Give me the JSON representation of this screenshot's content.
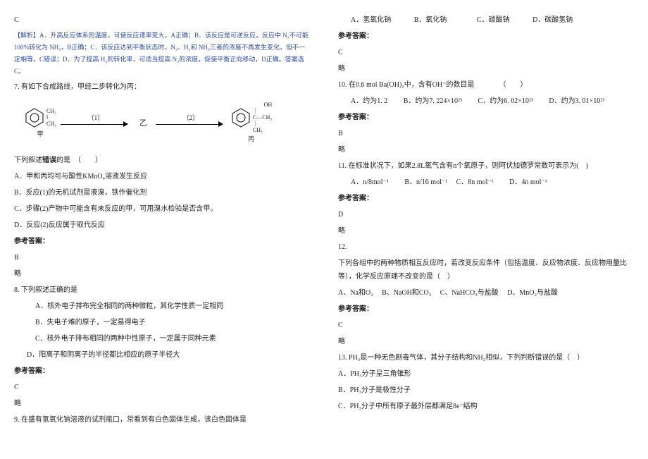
{
  "left": {
    "ansLetterC": "C",
    "analysis": "【解析】A．升高反应体系的温度，可使反应速率变大，A正确；B．该反应是可逆反应，反应中 N₂不可能 100%转化为 NH₃，B正确；C．该反应达到平衡状态时，N₂、H₂和 NH₃三者的浓度不再发生变化，但不一定相等，C错误；D．为了提高 H₂的转化率，可适当提高 N₂的浓度，促使平衡正向移动，D正确。答案选 C。",
    "q7": "7. 有如下合成路线，甲经二步转化为丙：",
    "q7_hint": "下列叙述错误的是　（　　）",
    "q7a": "A．甲和丙均可与酸性KMnO₄溶液发生反应",
    "q7b": "B．反应(1)的无机试剂是液溴，铁作催化剂",
    "q7c": "C．步骤(2)产物中可能含有未反应的甲，可用溴水检验是否含甲。",
    "q7d": "D．反应(2)反应属于取代反应",
    "ansLabel": "参考答案：",
    "ansB": "B",
    "omit": "略",
    "q8": "8. 下列叙述正确的是",
    "q8a": "A．核外电子排布完全相同的两种微粒，其化学性质一定相同",
    "q8b": "B．失电子难的原子，一定易得电子",
    "q8c": "C．核外电子排布相同的两种中性原子，一定属于同种元素",
    "q8d": "D．阳离子和阴离子的半径都比相应的原子半径大",
    "ansC8": "C",
    "q9": "9. 在盛有氢氧化钠溶液的试剂瓶口，常看到有白色固体生成，该白色固体是",
    "diagram": {
      "label_jia": "甲",
      "label_bing": "丙",
      "sub1_top": "CH₂",
      "sub1_bottom": "CH₃",
      "prod_top": "OH",
      "prod_mid": "C—CH₃",
      "prod_bottom": "CH₃",
      "mid": "乙",
      "step1": "（1）",
      "step2": "（2）"
    }
  },
  "right": {
    "q9a": "A．氢氧化钠",
    "q9b": "B．氧化钠",
    "q9c": "C．碳酸钠",
    "q9d": "D．碳酸氢钠",
    "ansLabel": "参考答案：",
    "ansC9": "C",
    "omit": "略",
    "q10": "10. 在0.6 mol Ba(OH)₂中，含有OH⁻的数目是　　　　（　　）",
    "q10a": "A．约为1. 2",
    "q10b": "B．约为7. 224×10²³",
    "q10c": "C．约为6. 02×10²³",
    "q10d": "D．约为3. 01×10²³",
    "ansB10": "B",
    "q11": "11. 在标准状况下，如果2.8L氧气含有n个氧原子，则阿伏加德罗常数可表示为(　)",
    "q11a": "A．n/8mol⁻¹",
    "q11b": "B．n/16 mol⁻¹",
    "q11c": "C．8n mol⁻¹",
    "q11d": "D．4n mol⁻¹",
    "ansD11": "D",
    "q12_num": "12.",
    "q12": "下列各组中的两种物质相互反应时，若改变反应条件（包括温度、反应物浓度、反应物用量比等），化学反应原理不改变的是（　）",
    "q12a": "A、Na和O₂",
    "q12b": "B、NaOH和CO₂",
    "q12c": "C、NaHCO₃与盐酸",
    "q12d": "D、MnO₂与盐酸",
    "ansC12": "C",
    "q13": "13. PH₃是一种无色剧毒气体，其分子结构和NH₃相似，下列判断错误的是（　）",
    "q13a": "A．PH₃分子呈三角锥形",
    "q13b": "B．PH₃分子是极性分子",
    "q13c": "C．PH₃分子中所有原子最外层都满足8e⁻结构"
  }
}
